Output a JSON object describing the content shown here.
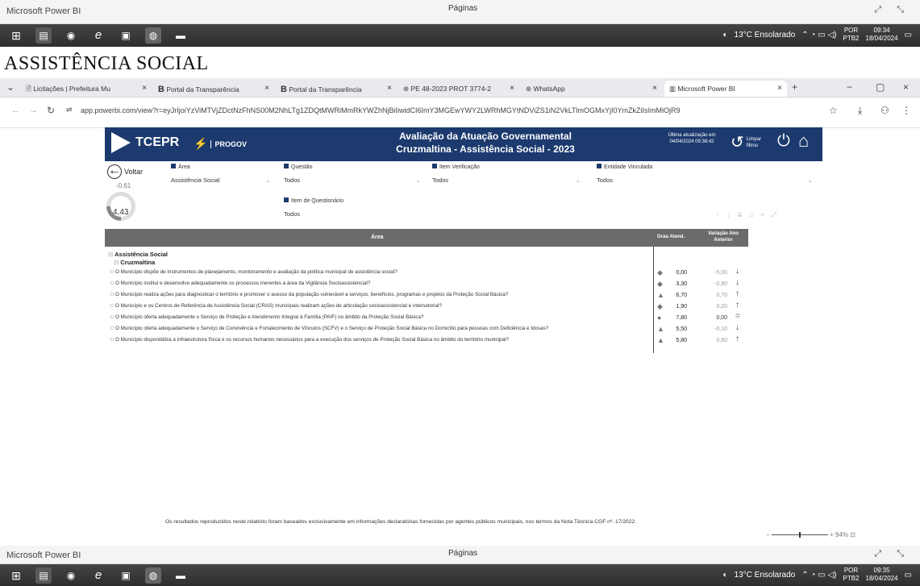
{
  "top": {
    "app": "Microsoft Power BI",
    "center": "Páginas"
  },
  "heading": "ASSISTÊNCIA SOCIAL",
  "browser": {
    "tabs": [
      "Licitações | Prefeitura Mu",
      "Portal da Transparência",
      "Portal da Transparência",
      "PE 48-2023 PROT 3774-2",
      "WhatsApp",
      "Microsoft Power BI"
    ],
    "url": "app.powerbi.com/view?r=eyJrIjoiYzViMTVjZDctNzFhNS00M2NhLTg1ZDQtMWRiMmRkYWZhNjBiIiwidCI6ImY3MGEwYWY2LWRhMGYtNDViZS1iN2VkLTlmOGMxYjI0YmZkZiIsImMiOjR9"
  },
  "report": {
    "brand": "TCEPR",
    "brand2": "PROGOV",
    "title_line1": "Avaliação da Atuação Governamental",
    "title_line2": "Cruzmaltina - Assistência Social - 2023",
    "update_label": "Última atualização em",
    "update_value": "04/04/2024 09:38:42",
    "clear_filters": "Limpar filtros",
    "back": "Voltar",
    "score_delta": "-0,61",
    "score": "4,43",
    "filters": {
      "area_label": "Área",
      "area_value": "Assistência Social",
      "questao_label": "Questão",
      "questao_value": "Todos",
      "item_label": "Item Verificação",
      "item_value": "Todos",
      "entidade_label": "Entidade Vinculada",
      "entidade_value": "Todos",
      "questionario_label": "Item de Questionário",
      "questionario_value": "Todos"
    },
    "table": {
      "col_area": "Área",
      "col_grau": "Grau Atend.",
      "col_var": "Variação Ano Anterior",
      "group": "Assistência Social",
      "subgroup": "Cruzmaltina",
      "rows": [
        {
          "text": "O Município dispõe de instrumentos de planejamento, monitoramento e avaliação da política municipal de assistência social?",
          "grau": "0,00",
          "var": "-5,00",
          "dir": "down"
        },
        {
          "text": "O Município institui e desenvolve adequadamente os processos inerentes à área da Vigilância Socioassistencial?",
          "grau": "3,30",
          "var": "-0,90",
          "dir": "down"
        },
        {
          "text": "O Município realiza ações para diagnosticar o território e promover o acesso da população vulnerável a serviços, benefícios, programas e projetos da Proteção Social Básica?",
          "grau": "6,70",
          "var": "0,70",
          "dir": "up"
        },
        {
          "text": "O Município e os Centros de Referência de Assistência Social (CRAS) municipais realizam ações de articulação socioassistencial e intersetorial?",
          "grau": "1,90",
          "var": "0,20",
          "dir": "up"
        },
        {
          "text": "O Município oferta adequadamente o Serviço de Proteção e Atendimento Integral à Família (PAIF) no âmbito da Proteção Social Básica?",
          "grau": "7,80",
          "var": "0,00",
          "dir": "flat"
        },
        {
          "text": "O Município oferta adequadamente o Serviço de Convivência e Fortalecimento de Vínculos (SCFV) e o Serviço de Proteção Social Básica no Domicílio para pessoas com Deficiência e Idosas?",
          "grau": "5,50",
          "var": "-0,10",
          "dir": "down"
        },
        {
          "text": "O Município disponibiliza a infraestrutura física e os recursos humanos necessários para a execução dos serviços de Proteção Social Básica no âmbito do território municipal?",
          "grau": "5,80",
          "var": "0,60",
          "dir": "up"
        }
      ]
    },
    "footer": "Os resultados reproduzidos neste relatório foram baseados exclusivamente em informações declaratórias fornecidas por agentes públicos municipais, nos termos da Nota Técnica CGF nº. 17/2022.",
    "zoom": "94%"
  },
  "taskbar": {
    "weather": "13°C Ensolarado",
    "lang1": "POR",
    "lang2": "PTB2",
    "time_top": "09:34",
    "date_top": "18/04/2024",
    "time_bottom": "09:35",
    "date_bottom": "18/04/2024"
  }
}
